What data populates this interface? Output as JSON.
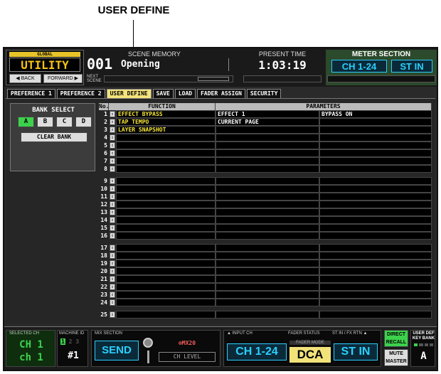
{
  "callout": "USER DEFINE",
  "header": {
    "global_label": "GLOBAL",
    "module": "UTILITY",
    "back": "◀ BACK",
    "forward": "FORWARD ▶",
    "scene_title": "SCENE MEMORY",
    "scene_number": "001",
    "scene_name": "Opening",
    "next_scene": "NEXT SCENE",
    "time_title": "PRESENT TIME",
    "time": "1:03:19",
    "meter_title": "METER SECTION",
    "meter_ch": "CH 1-24",
    "meter_st": "ST IN"
  },
  "tabs": [
    "PREFERENCE 1",
    "PREFERENCE 2",
    "USER DEFINE",
    "SAVE",
    "LOAD",
    "FADER ASSIGN",
    "SECURITY"
  ],
  "active_tab": "USER DEFINE",
  "bank": {
    "title": "BANK SELECT",
    "buttons": [
      "A",
      "B",
      "C",
      "D"
    ],
    "selected": "A",
    "clear": "CLEAR BANK"
  },
  "table": {
    "col_no": "No.",
    "col_function": "FUNCTION",
    "col_parameters": "PARAMETERS",
    "rows": [
      {
        "no": "1",
        "fn": "EFFECT BYPASS",
        "p1": "EFFECT 1",
        "p2": "BYPASS ON"
      },
      {
        "no": "2",
        "fn": "TAP TEMPO",
        "p1": "CURRENT PAGE",
        "p2": ""
      },
      {
        "no": "3",
        "fn": "LAYER SNAPSHOT",
        "p1": "",
        "p2": ""
      },
      {
        "no": "4",
        "fn": "",
        "p1": "",
        "p2": ""
      },
      {
        "no": "5",
        "fn": "",
        "p1": "",
        "p2": ""
      },
      {
        "no": "6",
        "fn": "",
        "p1": "",
        "p2": ""
      },
      {
        "no": "7",
        "fn": "",
        "p1": "",
        "p2": ""
      },
      {
        "no": "8",
        "fn": "",
        "p1": "",
        "p2": ""
      },
      {
        "no": "9",
        "fn": "",
        "p1": "",
        "p2": ""
      },
      {
        "no": "10",
        "fn": "",
        "p1": "",
        "p2": ""
      },
      {
        "no": "11",
        "fn": "",
        "p1": "",
        "p2": ""
      },
      {
        "no": "12",
        "fn": "",
        "p1": "",
        "p2": ""
      },
      {
        "no": "13",
        "fn": "",
        "p1": "",
        "p2": ""
      },
      {
        "no": "14",
        "fn": "",
        "p1": "",
        "p2": ""
      },
      {
        "no": "15",
        "fn": "",
        "p1": "",
        "p2": ""
      },
      {
        "no": "16",
        "fn": "",
        "p1": "",
        "p2": ""
      },
      {
        "no": "17",
        "fn": "",
        "p1": "",
        "p2": ""
      },
      {
        "no": "18",
        "fn": "",
        "p1": "",
        "p2": ""
      },
      {
        "no": "19",
        "fn": "",
        "p1": "",
        "p2": ""
      },
      {
        "no": "20",
        "fn": "",
        "p1": "",
        "p2": ""
      },
      {
        "no": "21",
        "fn": "",
        "p1": "",
        "p2": ""
      },
      {
        "no": "22",
        "fn": "",
        "p1": "",
        "p2": ""
      },
      {
        "no": "23",
        "fn": "",
        "p1": "",
        "p2": ""
      },
      {
        "no": "24",
        "fn": "",
        "p1": "",
        "p2": ""
      },
      {
        "no": "25",
        "fn": "",
        "p1": "",
        "p2": ""
      }
    ],
    "groups": [
      [
        0,
        8
      ],
      [
        8,
        16
      ],
      [
        16,
        24
      ],
      [
        24,
        25
      ]
    ]
  },
  "footer": {
    "selected_ch_label": "SELECTED CH",
    "selected_ch": "CH 1",
    "selected_ch_name": "ch 1",
    "machine_id_label": "MACHINE ID",
    "machine_ids": [
      "1",
      "2",
      "3"
    ],
    "machine_id": "#1",
    "mix_section_label": "MIX SECTION",
    "mix_mode": "SEND",
    "mix_bus": "⊗MX20",
    "ch_level": "CH LEVEL",
    "input_ch_label": "▲ INPUT CH",
    "input_ch": "CH 1-24",
    "fader_status_label": "FADER STATUS",
    "fader_mode_label": "FADER MODE",
    "fader_mode": "DCA",
    "st_in_label": "ST IN / FX RTN ▲",
    "st_in": "ST IN",
    "direct_recall": "DIRECT RECALL",
    "mute_master": "MUTE MASTER",
    "user_def_label": "USER DEF KEY BANK",
    "user_bank": "A"
  },
  "colors": {
    "accent_yellow": "#f5e436",
    "active_tab": "#f2e27a",
    "cyan": "#2ad0ff",
    "green": "#3cd24c"
  }
}
